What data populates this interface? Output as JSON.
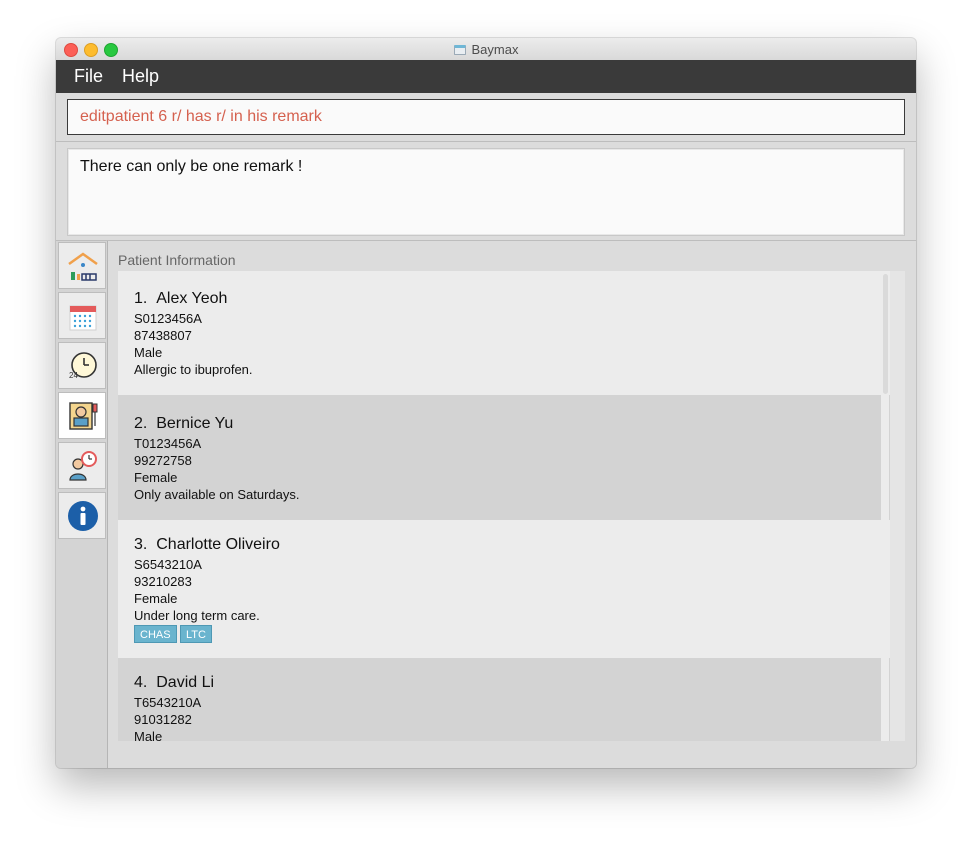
{
  "window": {
    "title": "Baymax"
  },
  "menu": {
    "file": "File",
    "help": "Help"
  },
  "command_box": {
    "value": "editpatient 6 r/ has r/ in his remark"
  },
  "result_box": {
    "text": "There can only be one remark !"
  },
  "sidebar": {
    "tabs": [
      {
        "icon": "home-icon"
      },
      {
        "icon": "calendar-icon"
      },
      {
        "icon": "clock-24h-icon"
      },
      {
        "icon": "patient-info-icon"
      },
      {
        "icon": "patient-appointment-icon"
      },
      {
        "icon": "info-icon"
      }
    ]
  },
  "panel": {
    "title": "Patient Information",
    "patients": [
      {
        "index": "1.",
        "name": "Alex Yeoh",
        "nric": "S0123456A",
        "phone": "87438807",
        "gender": "Male",
        "remark": "Allergic to ibuprofen.",
        "tags": []
      },
      {
        "index": "2.",
        "name": "Bernice Yu",
        "nric": "T0123456A",
        "phone": "99272758",
        "gender": "Female",
        "remark": "Only available on Saturdays.",
        "tags": []
      },
      {
        "index": "3.",
        "name": "Charlotte Oliveiro",
        "nric": "S6543210A",
        "phone": "93210283",
        "gender": "Female",
        "remark": "Under long term care.",
        "tags": [
          "CHAS",
          "LTC"
        ]
      },
      {
        "index": "4.",
        "name": "David Li",
        "nric": "T6543210A",
        "phone": "91031282",
        "gender": "Male",
        "remark": "",
        "tags": []
      }
    ]
  },
  "colors": {
    "menubar": "#3a3a3a",
    "command_text": "#d5614f",
    "tag_bg": "#6ab4ce"
  }
}
